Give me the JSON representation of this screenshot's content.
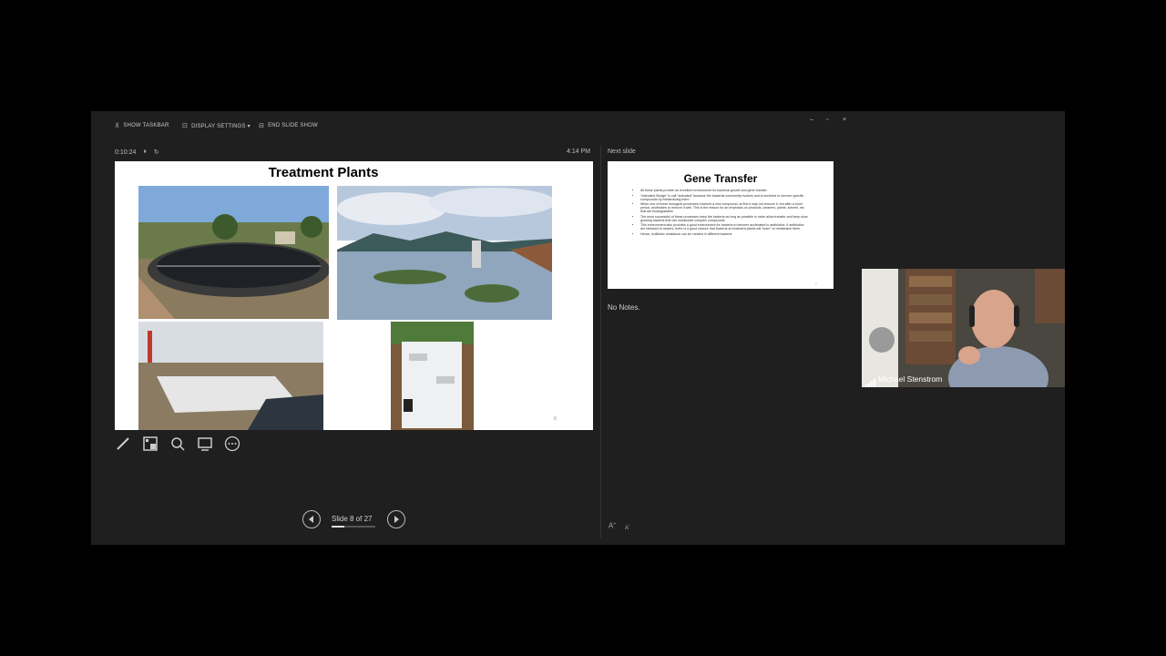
{
  "toolbar": {
    "show_taskbar": "SHOW TASKBAR",
    "display_settings": "DISPLAY SETTINGS ▾",
    "end_slide_show": "END SLIDE SHOW"
  },
  "window_controls": {
    "minimize": "–",
    "restore": "▫",
    "close": "×"
  },
  "timer": {
    "elapsed": "0:10:24",
    "pause_icon": "pause-icon",
    "reset_icon": "restart-icon"
  },
  "clock": "4:14 PM",
  "current_slide": {
    "title": "Treatment Plants",
    "number": "8"
  },
  "next_slide": {
    "label": "Next slide",
    "title": "Gene Transfer",
    "bullets": [
      "All these plants provide an excellent environment for bacterial growth and gene transfer",
      "“Activated Sludge” is call “activated” because the bacterial community evolves and is enriched to remove specific compounds by metabolizing them",
      "When one of these biological processes received a new compound, at first it may not remove it, but after a short period, acclimates to remove it well. This is the reason for an emphasis on products, cleaners, paints, solvent, etc. that are biodegradable",
      "The most successful of these processes keep the bacteria as long as possible in order allow transfer and keep slow growing bacteria that can metabolize complex compounds",
      "This environment also provides a good environment for bacteria to become acclimated to antibiotics. If antibiotics are released to sewers, there is a good chance that bacteria at treatment plants will “learn” to metabolize them",
      "Hence, Antibiotic resistance can be created in different bacteria"
    ],
    "number": "9"
  },
  "notes": "No Notes.",
  "font_buttons": {
    "increase": "A",
    "decrease": "A"
  },
  "navigation": {
    "slide_count": "Slide 8 of 27",
    "progress": 0.296
  },
  "tools": [
    "pen-icon",
    "grid-icon",
    "zoom-icon",
    "screen-icon",
    "more-icon"
  ],
  "video": {
    "participant_name": "Michael Stenstrom"
  },
  "colors": {
    "background": "#000000",
    "window": "#1f1f1f",
    "text": "#c8c8c8"
  }
}
